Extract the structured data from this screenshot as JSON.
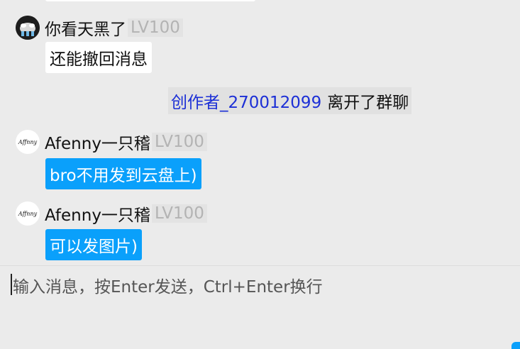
{
  "messages": [
    {
      "sender": "你看天黑了",
      "level": "LV100",
      "text": "还能撤回消息",
      "style": "white",
      "avatar": "dark-cartoon-avatar"
    },
    {
      "sender": "Afenny一只稽",
      "level": "LV100",
      "text": "bro不用发到云盘上)",
      "style": "blue",
      "avatar": "afenny-logo-avatar",
      "avatar_text": "Affnny"
    },
    {
      "sender": "Afenny一只稽",
      "level": "LV100",
      "text": "可以发图片)",
      "style": "blue",
      "avatar": "afenny-logo-avatar",
      "avatar_text": "Affnny"
    }
  ],
  "system_notice": {
    "user": "创作者_270012099",
    "action": "离开了群聊"
  },
  "input": {
    "placeholder": "输入消息，按Enter发送，Ctrl+Enter换行"
  },
  "colors": {
    "bubble_blue": "#0aa0fb",
    "system_user": "#1c2fd6",
    "background": "#ebebeb",
    "level_text": "#b3b3b3"
  }
}
